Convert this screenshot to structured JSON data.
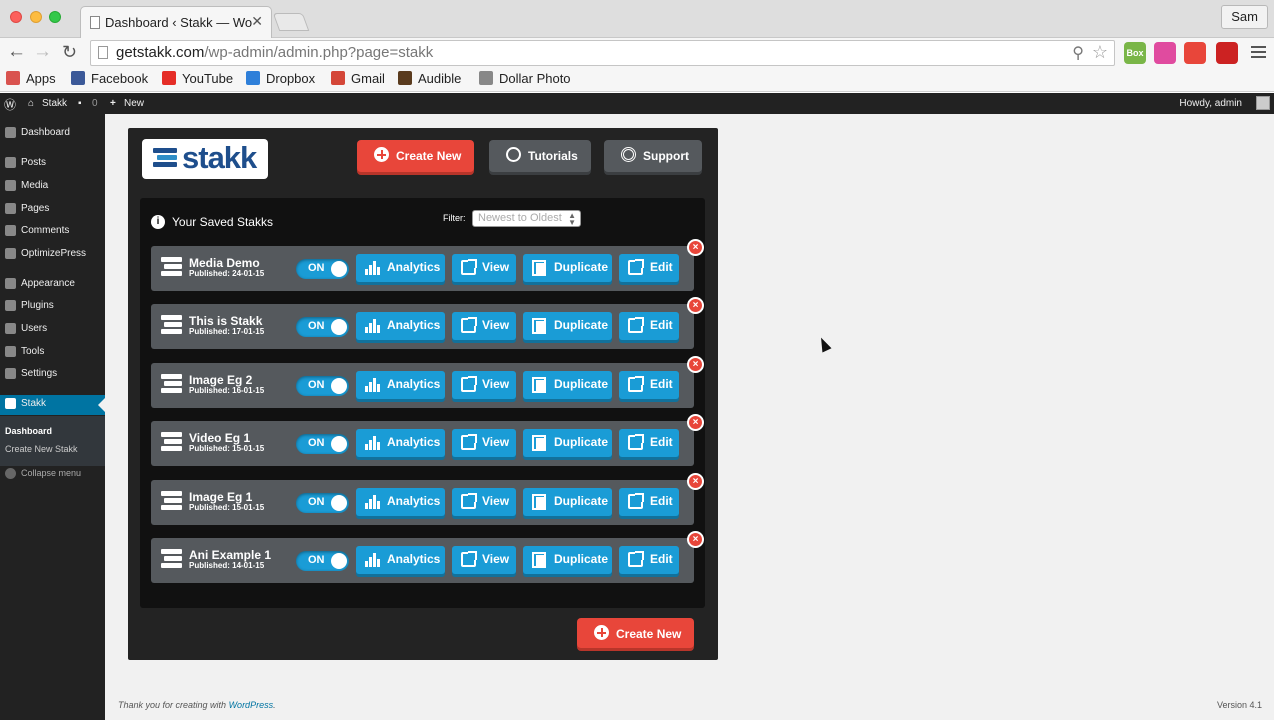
{
  "browser": {
    "tab_title": "Dashboard ‹ Stakk — Word",
    "tab_close": "✕",
    "user": "Sam",
    "url_host": "getstakk.com",
    "url_path": "/wp-admin/admin.php?page=stakk",
    "extensions": [
      {
        "name": "box-on-icon",
        "text": "Box ON",
        "color": "#7ab648"
      },
      {
        "name": "color-wheel-icon",
        "text": "",
        "color": "#e04b9f"
      },
      {
        "name": "star-badge-icon",
        "text": "",
        "color": "#e8463a"
      },
      {
        "name": "hand-icon",
        "text": "",
        "color": "#cc2222"
      }
    ],
    "bookmarks": [
      {
        "name": "bookmark-apps",
        "label": "Apps",
        "color": "#d9534f"
      },
      {
        "name": "bookmark-facebook",
        "label": "Facebook",
        "color": "#3b5998"
      },
      {
        "name": "bookmark-youtube",
        "label": "YouTube",
        "color": "#e52d27"
      },
      {
        "name": "bookmark-dropbox",
        "label": "Dropbox",
        "color": "#2e7fd9"
      },
      {
        "name": "bookmark-gmail",
        "label": "Gmail",
        "color": "#d44638"
      },
      {
        "name": "bookmark-audible",
        "label": "Audible",
        "color": "#5a3b1e"
      },
      {
        "name": "bookmark-dollar-photo",
        "label": "Dollar Photo",
        "color": "#888888"
      }
    ]
  },
  "adminbar": {
    "site": "Stakk",
    "comments": "0",
    "new": "New",
    "greeting": "Howdy, admin"
  },
  "sidebar": {
    "items": [
      {
        "name": "sidebar-item-dashboard",
        "label": "Dashboard"
      },
      {
        "name": "sidebar-item-posts",
        "label": "Posts"
      },
      {
        "name": "sidebar-item-media",
        "label": "Media"
      },
      {
        "name": "sidebar-item-pages",
        "label": "Pages"
      },
      {
        "name": "sidebar-item-comments",
        "label": "Comments"
      },
      {
        "name": "sidebar-item-optimizepress",
        "label": "OptimizePress"
      },
      {
        "name": "sidebar-item-appearance",
        "label": "Appearance"
      },
      {
        "name": "sidebar-item-plugins",
        "label": "Plugins"
      },
      {
        "name": "sidebar-item-users",
        "label": "Users"
      },
      {
        "name": "sidebar-item-tools",
        "label": "Tools"
      },
      {
        "name": "sidebar-item-settings",
        "label": "Settings"
      },
      {
        "name": "sidebar-item-stakk",
        "label": "Stakk"
      }
    ],
    "submenu": [
      "Dashboard",
      "Create New Stakk"
    ],
    "collapse": "Collapse menu"
  },
  "stakk": {
    "logo": "stakk",
    "create_new": "Create New",
    "tutorials": "Tutorials",
    "support": "Support",
    "saved_title": "Your Saved Stakks",
    "filter_label": "Filter:",
    "filter_value": "Newest to Oldest",
    "toggle_label": "ON",
    "actions": {
      "analytics": "Analytics",
      "view": "View",
      "duplicate": "Duplicate",
      "edit": "Edit"
    },
    "delete_glyph": "×",
    "rows": [
      {
        "name": "Media Demo",
        "published": "Published: 24-01-15"
      },
      {
        "name": "This is Stakk",
        "published": "Published: 17-01-15"
      },
      {
        "name": "Image Eg 2",
        "published": "Published: 16-01-15"
      },
      {
        "name": "Video Eg 1",
        "published": "Published: 15-01-15"
      },
      {
        "name": "Image Eg 1",
        "published": "Published: 15-01-15"
      },
      {
        "name": "Ani Example 1",
        "published": "Published: 14-01-15"
      }
    ]
  },
  "footer": {
    "thanks_prefix": "Thank you for creating with ",
    "thanks_link": "WordPress",
    "thanks_suffix": ".",
    "version": "Version 4.1"
  },
  "colors": {
    "accent_blue": "#1a9cd6",
    "accent_red": "#e8463a",
    "wp_active": "#0074a2"
  }
}
